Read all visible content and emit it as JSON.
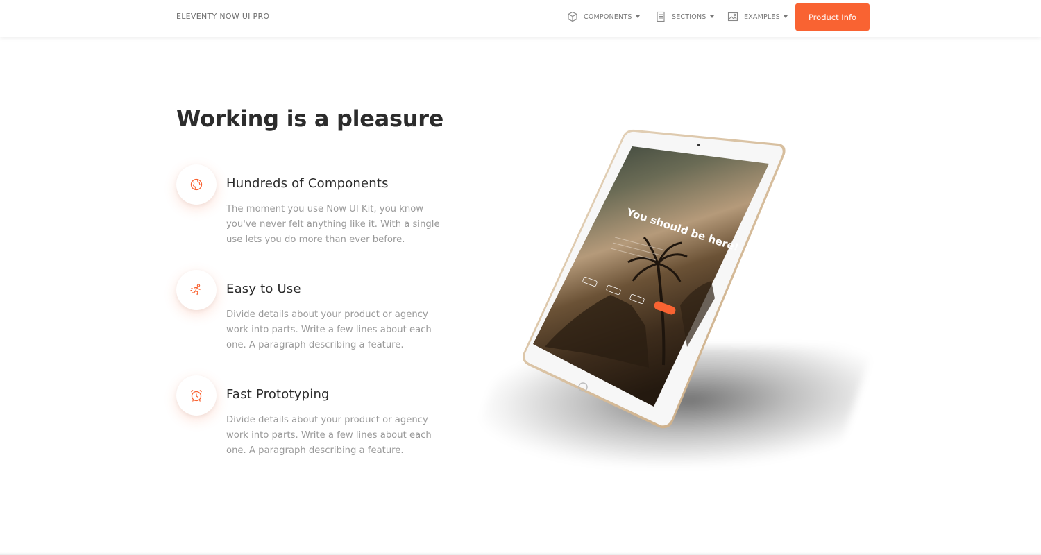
{
  "navbar": {
    "brand": "ELEVENTY NOW UI PRO",
    "items": [
      {
        "label": "COMPONENTS",
        "icon": "box-icon"
      },
      {
        "label": "SECTIONS",
        "icon": "document-icon"
      },
      {
        "label": "EXAMPLES",
        "icon": "image-icon"
      }
    ],
    "cta_label": "Product Info"
  },
  "main": {
    "title": "Working is a pleasure",
    "features": [
      {
        "icon": "globe-icon",
        "title": "Hundreds of Components",
        "text": "The moment you use Now UI Kit, you know you've never felt anything like it. With a single use lets you do more than ever before."
      },
      {
        "icon": "runner-icon",
        "title": "Easy to Use",
        "text": "Divide details about your product or agency work into parts. Write a few lines about each one. A paragraph describing a feature."
      },
      {
        "icon": "alarm-clock-icon",
        "title": "Fast Prototyping",
        "text": "Divide details about your product or agency work into parts. Write a few lines about each one. A paragraph describing a feature."
      }
    ]
  },
  "tablet_screen": {
    "headline": "You should be here!"
  },
  "colors": {
    "accent": "#f96332",
    "heading": "#2c2c2c",
    "muted_text": "#9a9a9a"
  }
}
